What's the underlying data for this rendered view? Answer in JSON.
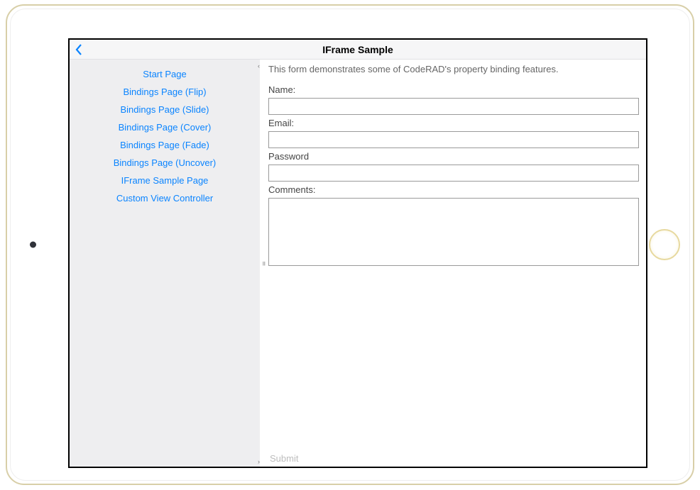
{
  "header": {
    "title": "IFrame Sample"
  },
  "sidebar": {
    "items": [
      "Start Page",
      "Bindings Page (Flip)",
      "Bindings Page (Slide)",
      "Bindings Page (Cover)",
      "Bindings Page (Fade)",
      "Bindings Page (Uncover)",
      "IFrame Sample Page",
      "Custom View Controller"
    ]
  },
  "form": {
    "description": "This form demonstrates some of CodeRAD's property binding features.",
    "name_label": "Name:",
    "name_value": "",
    "email_label": "Email:",
    "email_value": "",
    "password_label": "Password",
    "password_value": "",
    "comments_label": "Comments:",
    "comments_value": "",
    "submit_label": "Submit"
  },
  "splitter": {
    "collapse_left": "‹",
    "handle": "॥",
    "collapse_right": "›"
  }
}
